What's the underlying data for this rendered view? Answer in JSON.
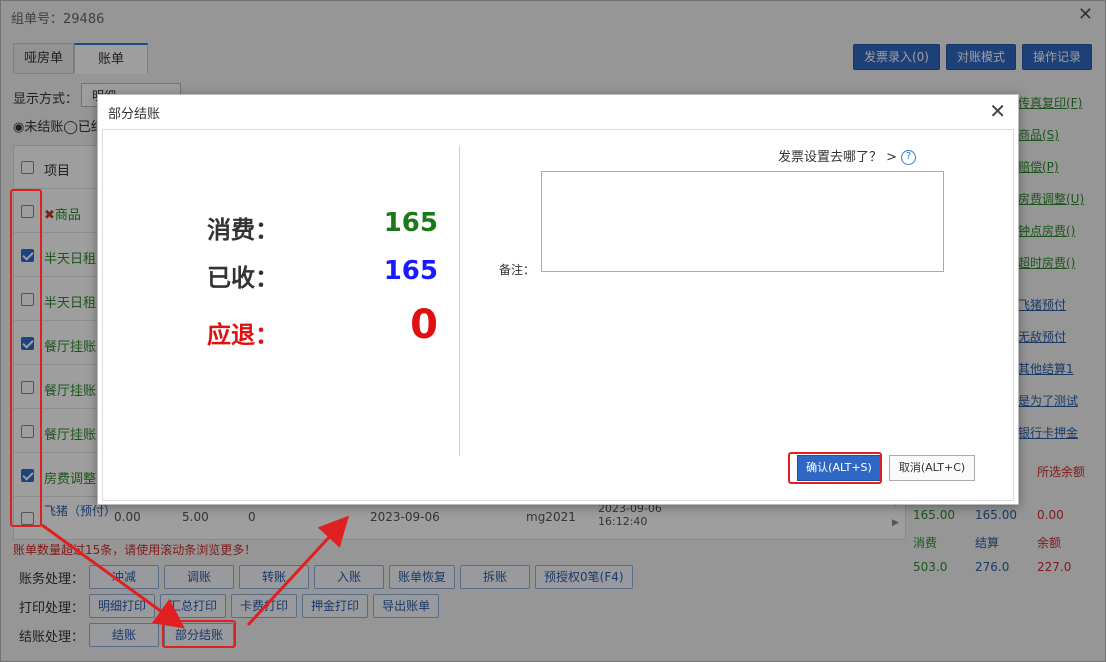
{
  "window": {
    "title": "组单号：29486"
  },
  "tabs": [
    {
      "label": "哑房单"
    },
    {
      "label": "账单"
    }
  ],
  "top_buttons": [
    {
      "label": "发票录入(0)"
    },
    {
      "label": "对账模式"
    },
    {
      "label": "操作记录"
    }
  ],
  "display": {
    "label": "显示方式：",
    "value": "明细"
  },
  "filters": {
    "unsettled": "◉未结账",
    "other": "◯已结"
  },
  "table": {
    "header": "项目",
    "rows": [
      {
        "label": "商品",
        "checked": false
      },
      {
        "label": "半天日租",
        "checked": true
      },
      {
        "label": "半天日租",
        "checked": false
      },
      {
        "label": "餐厅挂账",
        "checked": true
      },
      {
        "label": "餐厅挂账",
        "checked": false
      },
      {
        "label": "餐厅挂账",
        "checked": false
      },
      {
        "label": "房费调整",
        "checked": true
      }
    ],
    "last_row": {
      "item": "飞猪（预付）",
      "v1": "0.00",
      "v2": "5.00",
      "v3": "0",
      "date": "2023-09-06",
      "operator": "mg2021",
      "datetime": "2023-09-06 16:12:40"
    }
  },
  "warning": "账单数量超过15条，请使用滚动条浏览更多！",
  "operations": {
    "finance": {
      "label": "账务处理：",
      "buttons": [
        "冲减",
        "调账",
        "转账",
        "入账",
        "账单恢复",
        "拆账",
        "预授权0笔(F4)"
      ]
    },
    "print": {
      "label": "打印处理：",
      "buttons": [
        "明细打印",
        "汇总打印",
        "卡费打印",
        "押金打印",
        "导出账单"
      ]
    },
    "settle": {
      "label": "结账处理：",
      "buttons": [
        "结账",
        "部分结账"
      ]
    }
  },
  "right_links": [
    {
      "label": "传真复印(F)",
      "color": "green"
    },
    {
      "label": "商品(S)",
      "color": "green"
    },
    {
      "label": "赔偿(P)",
      "color": "green"
    },
    {
      "label": "房费调整(U)",
      "color": "green"
    },
    {
      "label": "钟点房费()",
      "color": "green"
    },
    {
      "label": "超时房费()",
      "color": "green"
    },
    {
      "label": "飞猪预付",
      "color": "blue"
    },
    {
      "label": "无敌预付",
      "color": "blue"
    },
    {
      "label": "其他结算1",
      "color": "blue"
    },
    {
      "label": "是为了测试",
      "color": "blue"
    },
    {
      "label": "银行卡押金",
      "color": "blue"
    }
  ],
  "summary": {
    "selected_balance_label": "所选余额",
    "selected_values": [
      "165.00",
      "165.00",
      "0.00"
    ],
    "labels": [
      "消费",
      "结算",
      "余额"
    ],
    "totals": [
      "503.0",
      "276.0",
      "227.0"
    ]
  },
  "dialog": {
    "title": "部分结账",
    "consume_label": "消费：",
    "consume_value": "165",
    "received_label": "已收：",
    "received_value": "165",
    "refund_label": "应退：",
    "refund_value": "0",
    "invoice_hint": "发票设置去哪了？ >",
    "remark_label": "备注：",
    "remark_value": "",
    "confirm_label": "确认(ALT+S)",
    "cancel_label": "取消(ALT+C)"
  },
  "colors": {
    "accent": "#2f68c4",
    "green": "#2e8b2e",
    "blue": "#1a1aff",
    "red": "#e01010"
  }
}
